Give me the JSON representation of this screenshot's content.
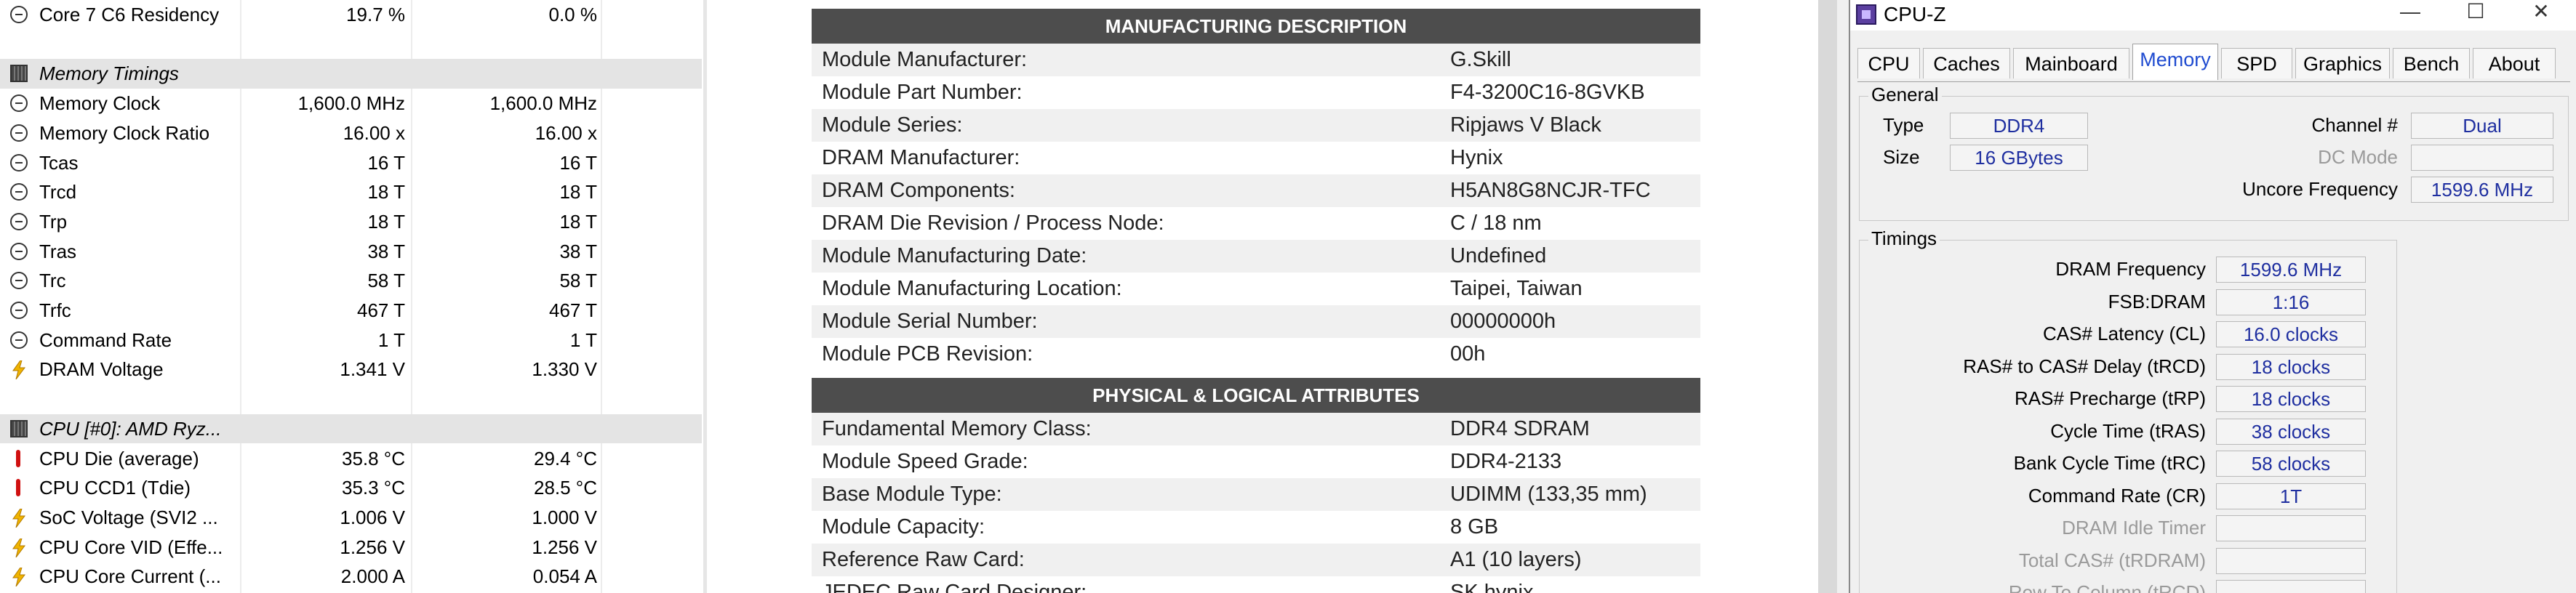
{
  "hwinfo": {
    "rows": [
      {
        "kind": "row",
        "icon": "clock-icon",
        "label": "Core 7 C6 Residency",
        "current": "19.7 %",
        "min": "0.0 %"
      },
      {
        "kind": "blank"
      },
      {
        "kind": "section",
        "icon": "chip-icon",
        "label": "Memory Timings"
      },
      {
        "kind": "row",
        "icon": "clock-icon",
        "label": "Memory Clock",
        "current": "1,600.0 MHz",
        "min": "1,600.0 MHz"
      },
      {
        "kind": "row",
        "icon": "clock-icon",
        "label": "Memory Clock Ratio",
        "current": "16.00 x",
        "min": "16.00 x"
      },
      {
        "kind": "row",
        "icon": "clock-icon",
        "label": "Tcas",
        "current": "16 T",
        "min": "16 T"
      },
      {
        "kind": "row",
        "icon": "clock-icon",
        "label": "Trcd",
        "current": "18 T",
        "min": "18 T"
      },
      {
        "kind": "row",
        "icon": "clock-icon",
        "label": "Trp",
        "current": "18 T",
        "min": "18 T"
      },
      {
        "kind": "row",
        "icon": "clock-icon",
        "label": "Tras",
        "current": "38 T",
        "min": "38 T"
      },
      {
        "kind": "row",
        "icon": "clock-icon",
        "label": "Trc",
        "current": "58 T",
        "min": "58 T"
      },
      {
        "kind": "row",
        "icon": "clock-icon",
        "label": "Trfc",
        "current": "467 T",
        "min": "467 T"
      },
      {
        "kind": "row",
        "icon": "clock-icon",
        "label": "Command Rate",
        "current": "1 T",
        "min": "1 T"
      },
      {
        "kind": "row",
        "icon": "voltage-icon",
        "label": "DRAM Voltage",
        "current": "1.341 V",
        "min": "1.330 V"
      },
      {
        "kind": "blank"
      },
      {
        "kind": "section",
        "icon": "chip-icon",
        "label": "CPU [#0]: AMD Ryz..."
      },
      {
        "kind": "row",
        "icon": "thermometer-icon",
        "label": "CPU Die (average)",
        "current": "35.8 °C",
        "min": "29.4 °C"
      },
      {
        "kind": "row",
        "icon": "thermometer-icon",
        "label": "CPU CCD1 (Tdie)",
        "current": "35.3 °C",
        "min": "28.5 °C"
      },
      {
        "kind": "row",
        "icon": "voltage-icon",
        "label": "SoC Voltage (SVI2 ...",
        "current": "1.006 V",
        "min": "1.000 V"
      },
      {
        "kind": "row",
        "icon": "voltage-icon",
        "label": "CPU Core VID (Effe...",
        "current": "1.256 V",
        "min": "1.256 V"
      },
      {
        "kind": "row",
        "icon": "voltage-icon",
        "label": "CPU Core Current (...",
        "current": "2.000 A",
        "min": "0.054 A"
      }
    ]
  },
  "thaiphoon": {
    "manufacturing": {
      "header": "MANUFACTURING DESCRIPTION",
      "rows": [
        {
          "key": "Module Manufacturer:",
          "value": "G.Skill"
        },
        {
          "key": "Module Part Number:",
          "value": "F4-3200C16-8GVKB"
        },
        {
          "key": "Module Series:",
          "value": "Ripjaws V Black"
        },
        {
          "key": "DRAM Manufacturer:",
          "value": "Hynix"
        },
        {
          "key": "DRAM Components:",
          "value": "H5AN8G8NCJR-TFC"
        },
        {
          "key": "DRAM Die Revision / Process Node:",
          "value": "C / 18 nm"
        },
        {
          "key": "Module Manufacturing Date:",
          "value": "Undefined"
        },
        {
          "key": "Module Manufacturing Location:",
          "value": "Taipei, Taiwan"
        },
        {
          "key": "Module Serial Number:",
          "value": "00000000h"
        },
        {
          "key": "Module PCB Revision:",
          "value": "00h"
        }
      ]
    },
    "physical": {
      "header": "PHYSICAL & LOGICAL ATTRIBUTES",
      "rows": [
        {
          "key": "Fundamental Memory Class:",
          "value": "DDR4 SDRAM"
        },
        {
          "key": "Module Speed Grade:",
          "value": "DDR4-2133"
        },
        {
          "key": "Base Module Type:",
          "value": "UDIMM (133,35 mm)"
        },
        {
          "key": "Module Capacity:",
          "value": "8 GB"
        },
        {
          "key": "Reference Raw Card:",
          "value": "A1 (10 layers)"
        },
        {
          "key": "JEDEC Raw Card Designer:",
          "value": "SK hynix"
        }
      ]
    }
  },
  "cpuz": {
    "title": "CPU-Z",
    "window_controls": {
      "minimize": "—",
      "maximize": "☐",
      "close": "✕"
    },
    "tabs": [
      "CPU",
      "Caches",
      "Mainboard",
      "Memory",
      "SPD",
      "Graphics",
      "Bench",
      "About"
    ],
    "active_tab": "Memory",
    "general": {
      "title": "General",
      "type_label": "Type",
      "type_value": "DDR4",
      "size_label": "Size",
      "size_value": "16 GBytes",
      "channel_label": "Channel #",
      "channel_value": "Dual",
      "dcmode_label": "DC Mode",
      "dcmode_value": "",
      "uncore_label": "Uncore Frequency",
      "uncore_value": "1599.6 MHz"
    },
    "timings": {
      "title": "Timings",
      "rows": [
        {
          "label": "DRAM Frequency",
          "value": "1599.6 MHz",
          "dim": false
        },
        {
          "label": "FSB:DRAM",
          "value": "1:16",
          "dim": false
        },
        {
          "label": "CAS# Latency (CL)",
          "value": "16.0 clocks",
          "dim": false
        },
        {
          "label": "RAS# to CAS# Delay (tRCD)",
          "value": "18 clocks",
          "dim": false
        },
        {
          "label": "RAS# Precharge (tRP)",
          "value": "18 clocks",
          "dim": false
        },
        {
          "label": "Cycle Time (tRAS)",
          "value": "38 clocks",
          "dim": false
        },
        {
          "label": "Bank Cycle Time (tRC)",
          "value": "58 clocks",
          "dim": false
        },
        {
          "label": "Command Rate (CR)",
          "value": "1T",
          "dim": false
        },
        {
          "label": "DRAM Idle Timer",
          "value": "",
          "dim": true
        },
        {
          "label": "Total CAS# (tRDRAM)",
          "value": "",
          "dim": true
        },
        {
          "label": "Row To Column (tRCD)",
          "value": "",
          "dim": true
        }
      ]
    }
  }
}
